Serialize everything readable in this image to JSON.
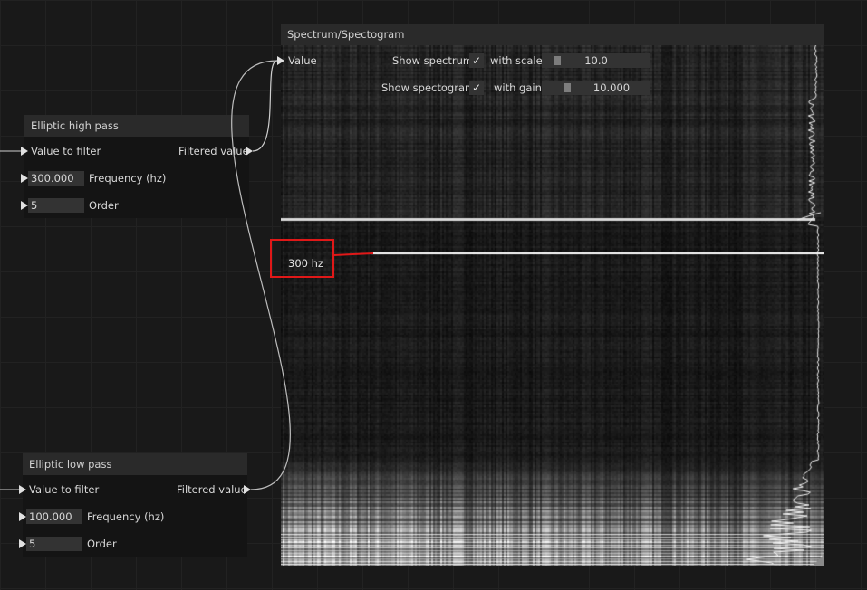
{
  "high_pass": {
    "title": "Elliptic high pass",
    "input_label": "Value to filter",
    "output_label": "Filtered value",
    "frequency_value": "300.000",
    "frequency_label": "Frequency (hz)",
    "order_value": "5",
    "order_label": "Order"
  },
  "low_pass": {
    "title": "Elliptic low pass",
    "input_label": "Value to filter",
    "output_label": "Filtered value",
    "frequency_value": "100.000",
    "frequency_label": "Frequency (hz)",
    "order_value": "5",
    "order_label": "Order"
  },
  "spectrum": {
    "title": "Spectrum/Spectogram",
    "value_label": "Value",
    "show_spectrum_label": "Show spectrum",
    "show_spectrum_checked": true,
    "scale_label": "with scale",
    "scale_value": "10.0",
    "show_spectogram_label": "Show spectogram",
    "show_spectogram_checked": true,
    "gain_label": "with gain",
    "gain_value": "10.000",
    "marker_label": "300 hz",
    "checkmark": "✓"
  },
  "colors": {
    "annotation_red": "#e01818",
    "node_title_bg": "#2a2a2a",
    "pin": "#e0e0e0"
  }
}
